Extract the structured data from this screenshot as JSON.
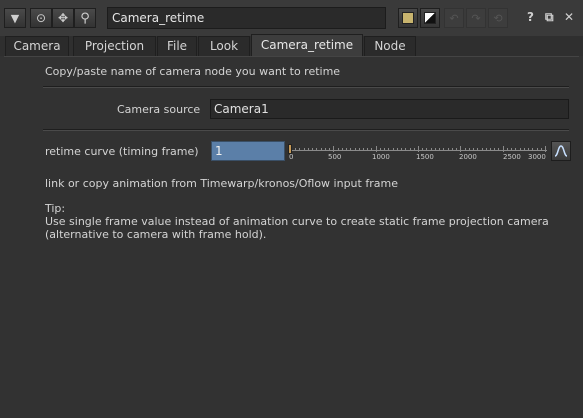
{
  "header": {
    "node_name": "Camera_retime"
  },
  "tabs": [
    {
      "label": "Camera"
    },
    {
      "label": "Projection"
    },
    {
      "label": "File"
    },
    {
      "label": "Look"
    },
    {
      "label": "Camera_retime",
      "active": true
    },
    {
      "label": "Node"
    }
  ],
  "main": {
    "instruction": "Copy/paste name of camera node you want to retime",
    "camera_source_label": "Camera source",
    "camera_source_value": "Camera1",
    "retime_label": "retime curve (timing frame)",
    "retime_value": "1",
    "slider_ticks": [
      "0",
      "500",
      "1000",
      "1500",
      "2000",
      "2500",
      "3000"
    ],
    "link_note": "link or copy animation from Timewarp/kronos/Oflow input frame",
    "tip_title": "Tip:",
    "tip_line1": "Use single frame value instead of animation curve to create static frame projection camera",
    "tip_line2": "(alternative to camera with frame hold)."
  },
  "colors": {
    "panel_bg": "#323232",
    "value_highlight": "#5b7fa8",
    "slider_knob": "#c89b57",
    "swatch_yellow": "#c8b46e"
  }
}
